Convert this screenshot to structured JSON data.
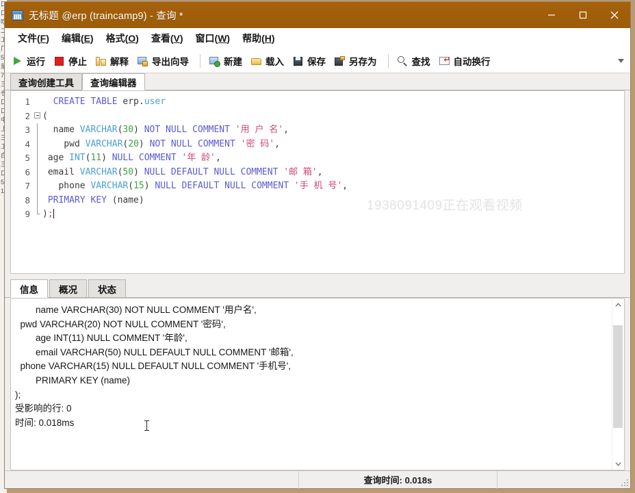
{
  "window": {
    "title": "无标题 @erp (traincamp9) - 查询 *",
    "icon": "database-table-icon",
    "controls": {
      "minimize": "minimize-icon",
      "maximize": "maximize-icon",
      "close": "close-icon"
    },
    "titlebar_color": "#9c5c09"
  },
  "menubar": {
    "items": [
      {
        "label": "文件",
        "mnemonic": "F"
      },
      {
        "label": "编辑",
        "mnemonic": "E"
      },
      {
        "label": "格式",
        "mnemonic": "O"
      },
      {
        "label": "查看",
        "mnemonic": "V"
      },
      {
        "label": "窗口",
        "mnemonic": "W"
      },
      {
        "label": "帮助",
        "mnemonic": "H"
      }
    ]
  },
  "toolbar": {
    "groups": [
      [
        {
          "label": "运行",
          "icon": "play-run-icon"
        },
        {
          "label": "停止",
          "icon": "stop-square-icon"
        },
        {
          "label": "解释",
          "icon": "explain-icon"
        },
        {
          "label": "导出向导",
          "icon": "export-wizard-icon"
        }
      ],
      [
        {
          "label": "新建",
          "icon": "new-query-icon"
        },
        {
          "label": "载入",
          "icon": "open-folder-icon"
        },
        {
          "label": "保存",
          "icon": "save-disk-icon"
        },
        {
          "label": "另存为",
          "icon": "save-as-icon"
        }
      ],
      [
        {
          "label": "查找",
          "icon": "search-icon"
        },
        {
          "label": "自动换行",
          "icon": "word-wrap-icon"
        }
      ]
    ],
    "overflow_icon": "chevron-down-icon"
  },
  "editor_tabs": [
    {
      "label": "查询创建工具",
      "active": false
    },
    {
      "label": "查询编辑器",
      "active": true
    }
  ],
  "editor": {
    "watermark": "1938091409正在观看视频",
    "lines": [
      {
        "n": "1",
        "fold": "none",
        "tokens": [
          {
            "t": "  ",
            "c": "pun"
          },
          {
            "t": "CREATE TABLE ",
            "c": "kw"
          },
          {
            "t": "erp",
            "c": "id"
          },
          {
            "t": ".",
            "c": "pun"
          },
          {
            "t": "user",
            "c": "type"
          }
        ]
      },
      {
        "n": "2",
        "fold": "start",
        "tokens": [
          {
            "t": "(",
            "c": "pun"
          }
        ]
      },
      {
        "n": "3",
        "fold": "mid",
        "tokens": [
          {
            "t": "  name ",
            "c": "id"
          },
          {
            "t": "VARCHAR",
            "c": "type"
          },
          {
            "t": "(",
            "c": "pun"
          },
          {
            "t": "30",
            "c": "num"
          },
          {
            "t": ") ",
            "c": "pun"
          },
          {
            "t": "NOT NULL COMMENT ",
            "c": "kw"
          },
          {
            "t": "'用 户 名'",
            "c": "str"
          },
          {
            "t": ",",
            "c": "pun"
          }
        ]
      },
      {
        "n": "4",
        "fold": "mid",
        "tokens": [
          {
            "t": "    pwd ",
            "c": "id"
          },
          {
            "t": "VARCHAR",
            "c": "type"
          },
          {
            "t": "(",
            "c": "pun"
          },
          {
            "t": "20",
            "c": "num"
          },
          {
            "t": ") ",
            "c": "pun"
          },
          {
            "t": "NOT NULL COMMENT ",
            "c": "kw"
          },
          {
            "t": "'密 码'",
            "c": "str"
          },
          {
            "t": ",",
            "c": "pun"
          }
        ]
      },
      {
        "n": "5",
        "fold": "mid",
        "tokens": [
          {
            "t": " age ",
            "c": "id"
          },
          {
            "t": "INT",
            "c": "type"
          },
          {
            "t": "(",
            "c": "pun"
          },
          {
            "t": "11",
            "c": "num"
          },
          {
            "t": ") ",
            "c": "pun"
          },
          {
            "t": "NULL COMMENT ",
            "c": "kw"
          },
          {
            "t": "'年 龄'",
            "c": "str"
          },
          {
            "t": ",",
            "c": "pun"
          }
        ]
      },
      {
        "n": "6",
        "fold": "mid",
        "tokens": [
          {
            "t": " email ",
            "c": "id"
          },
          {
            "t": "VARCHAR",
            "c": "type"
          },
          {
            "t": "(",
            "c": "pun"
          },
          {
            "t": "50",
            "c": "num"
          },
          {
            "t": ") ",
            "c": "pun"
          },
          {
            "t": "NULL DEFAULT NULL COMMENT ",
            "c": "kw"
          },
          {
            "t": "'邮 箱'",
            "c": "str"
          },
          {
            "t": ",",
            "c": "pun"
          }
        ]
      },
      {
        "n": "7",
        "fold": "mid",
        "tokens": [
          {
            "t": "   phone ",
            "c": "id"
          },
          {
            "t": "VARCHAR",
            "c": "type"
          },
          {
            "t": "(",
            "c": "pun"
          },
          {
            "t": "15",
            "c": "num"
          },
          {
            "t": ") ",
            "c": "pun"
          },
          {
            "t": "NULL DEFAULT NULL COMMENT ",
            "c": "kw"
          },
          {
            "t": "'手 机 号'",
            "c": "str"
          },
          {
            "t": ",",
            "c": "pun"
          }
        ]
      },
      {
        "n": "8",
        "fold": "mid",
        "tokens": [
          {
            "t": " ",
            "c": "pun"
          },
          {
            "t": "PRIMARY KEY ",
            "c": "kw"
          },
          {
            "t": "(",
            "c": "pun"
          },
          {
            "t": "name",
            "c": "id"
          },
          {
            "t": ")",
            "c": "pun"
          }
        ]
      },
      {
        "n": "9",
        "fold": "end",
        "tokens": [
          {
            "t": ")",
            "c": "pun"
          },
          {
            "t": ";",
            "c": "str"
          }
        ],
        "caret": true
      }
    ]
  },
  "result_tabs": [
    {
      "label": "信息",
      "active": true
    },
    {
      "label": "概况",
      "active": false
    },
    {
      "label": "状态",
      "active": false
    }
  ],
  "results": {
    "lines": [
      "        name VARCHAR(30) NOT NULL COMMENT '用户名',",
      "  pwd VARCHAR(20) NOT NULL COMMENT '密码',",
      "        age INT(11) NULL COMMENT '年龄',",
      "        email VARCHAR(50) NULL DEFAULT NULL COMMENT '邮箱',",
      "  phone VARCHAR(15) NULL DEFAULT NULL COMMENT '手机号',",
      "        PRIMARY KEY (name)",
      ");",
      "受影响的行: 0",
      "时间: 0.018ms"
    ],
    "scrollbar": {
      "up_icon": "chevron-up-icon",
      "down_icon": "chevron-down-icon"
    }
  },
  "statusbar": {
    "cell_left": "",
    "query_time": "查询时间: 0.018s",
    "cell_right": ""
  },
  "backdrop": {
    "strip_lines": [
      "口",
      "口",
      "吃",
      "二",
      "工",
      "厂",
      "5",
      "是",
      "7",
      "三",
      "也",
      "口",
      "口",
      "中",
      "上",
      "三",
      "工",
      "白",
      "三",
      "口",
      "5",
      "1"
    ]
  }
}
